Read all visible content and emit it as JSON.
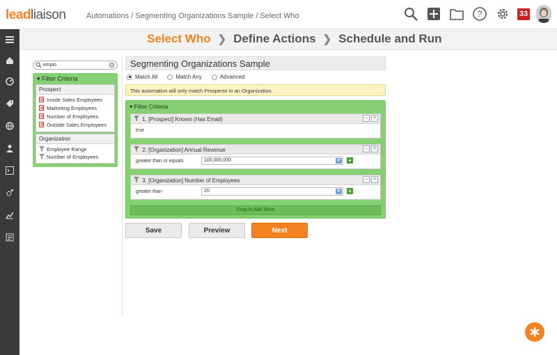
{
  "brand": {
    "part1": "lead",
    "part2": "liaison"
  },
  "breadcrumb": "Automations / Segmenting Organizations Sample / Select Who",
  "notifications_count": "33",
  "wizard": {
    "step1": "Select Who",
    "step2": "Define Actions",
    "step3": "Schedule and Run"
  },
  "left_panel": {
    "search_value": "emplo",
    "filter_title": "Filter Criteria",
    "prospect_group": {
      "title": "Prospect",
      "items": [
        "Inside Sales Employees",
        "Marketing Employees",
        "Number of Employees",
        "Outside Sales Employees"
      ]
    },
    "org_group": {
      "title": "Organization",
      "items": [
        "Employee Range",
        "Number of Employees"
      ]
    }
  },
  "main": {
    "automation_name": "Segmenting Organizations Sample",
    "match_options": [
      "Match All",
      "Match Any",
      "Advanced"
    ],
    "notice": "This automation will only match Prospects in an Organization.",
    "filter_title": "Filter Criteria",
    "criteria": [
      {
        "title": "1. [Prospect] Known (Has Email)",
        "body": "true"
      },
      {
        "title": "2. [Organization] Annual Revenue",
        "operator": "greater than or equals",
        "value": "100,000,000"
      },
      {
        "title": "3. [Organization] Number of Employees",
        "operator": "greater than",
        "value": "20"
      }
    ],
    "drag_label": "Drag to Add More"
  },
  "buttons": {
    "save": "Save",
    "preview": "Preview",
    "next": "Next"
  },
  "colors": {
    "accent": "#f58220",
    "filter_green": "#86cf74",
    "sidebar": "#3a3a3a"
  }
}
